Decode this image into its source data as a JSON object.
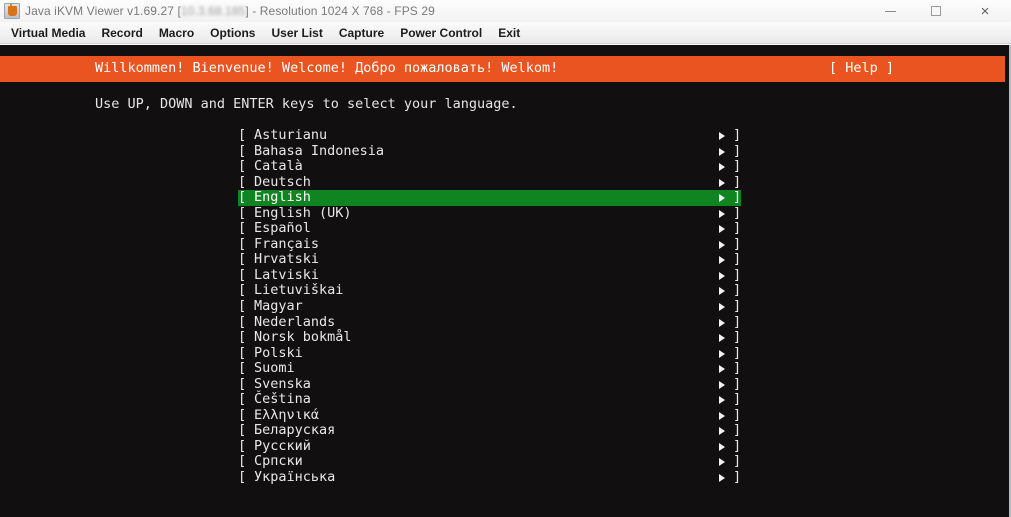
{
  "window": {
    "icon": "java-cup-icon",
    "title_prefix": "Java iKVM Viewer v1.69.27 [",
    "title_ip_redacted": "10.3.68.185",
    "title_suffix": "]  - Resolution 1024 X 768 - FPS 29",
    "controls": {
      "minimize": "—",
      "maximize": "□",
      "close": "×"
    }
  },
  "menubar": {
    "items": [
      {
        "label": "Virtual Media"
      },
      {
        "label": "Record"
      },
      {
        "label": "Macro"
      },
      {
        "label": "Options"
      },
      {
        "label": "User List"
      },
      {
        "label": "Capture"
      },
      {
        "label": "Power Control"
      },
      {
        "label": "Exit"
      }
    ]
  },
  "console": {
    "banner": {
      "greeting": "Willkommen! Bienvenue! Welcome! Добро пожаловать! Welkom!",
      "help": "[ Help ]",
      "background_color": "#e95420"
    },
    "hint": "Use UP, DOWN and ENTER keys to select your language.",
    "bracket_left": "[",
    "bracket_right": "]",
    "arrow_glyph": "►",
    "highlight_color": "#0f8420",
    "selected_index": 4,
    "languages": [
      {
        "label": "Asturianu"
      },
      {
        "label": "Bahasa Indonesia"
      },
      {
        "label": "Català"
      },
      {
        "label": "Deutsch"
      },
      {
        "label": "English"
      },
      {
        "label": "English (UK)"
      },
      {
        "label": "Español"
      },
      {
        "label": "Français"
      },
      {
        "label": "Hrvatski"
      },
      {
        "label": "Latviski"
      },
      {
        "label": "Lietuviškai"
      },
      {
        "label": "Magyar"
      },
      {
        "label": "Nederlands"
      },
      {
        "label": "Norsk bokmål"
      },
      {
        "label": "Polski"
      },
      {
        "label": "Suomi"
      },
      {
        "label": "Svenska"
      },
      {
        "label": "Čeština"
      },
      {
        "label": "Ελληνικά"
      },
      {
        "label": "Беларуская"
      },
      {
        "label": "Русский"
      },
      {
        "label": "Српски"
      },
      {
        "label": "Українська"
      }
    ]
  }
}
